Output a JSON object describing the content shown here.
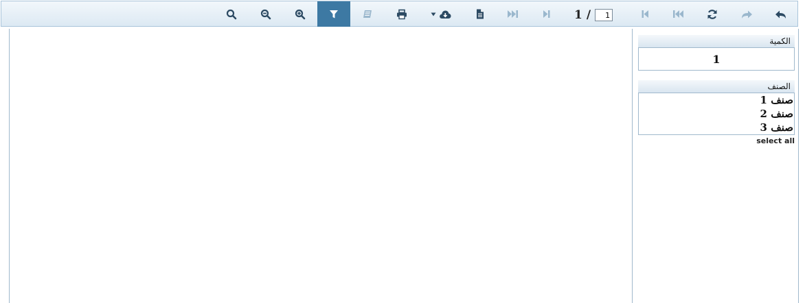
{
  "colors": {
    "toolbar_icon": "#2c4a63",
    "toolbar_icon_disabled": "#9ab7cd",
    "active_button_bg": "#3d79a3",
    "border": "#9fb8cc"
  },
  "toolbar": {
    "buttons": [
      {
        "icon": "search-icon",
        "state": "enabled"
      },
      {
        "icon": "zoom-out-icon",
        "state": "enabled"
      },
      {
        "icon": "zoom-in-icon",
        "state": "enabled"
      },
      {
        "icon": "filter-icon",
        "state": "active"
      },
      {
        "icon": "book-icon",
        "state": "disabled"
      },
      {
        "icon": "print-icon",
        "state": "enabled"
      },
      {
        "icon": "export-download-icon",
        "state": "enabled"
      },
      {
        "icon": "document-icon",
        "state": "enabled"
      },
      {
        "icon": "last-page-icon",
        "state": "disabled"
      },
      {
        "icon": "next-page-icon",
        "state": "disabled"
      },
      {
        "icon": "previous-page-icon",
        "state": "disabled"
      },
      {
        "icon": "first-page-icon",
        "state": "disabled"
      },
      {
        "icon": "refresh-icon",
        "state": "enabled"
      },
      {
        "icon": "redo-icon",
        "state": "disabled"
      },
      {
        "icon": "undo-back-icon",
        "state": "enabled"
      }
    ],
    "pager": {
      "total_pages": "1",
      "separator": "/",
      "current_page": "1"
    }
  },
  "params": {
    "quantity": {
      "label": "الكمية",
      "value": "1"
    },
    "category": {
      "label": "الصنف",
      "items": [
        "صنف 1",
        "صنف 2",
        "صنف 3"
      ],
      "select_all": "select all"
    }
  }
}
